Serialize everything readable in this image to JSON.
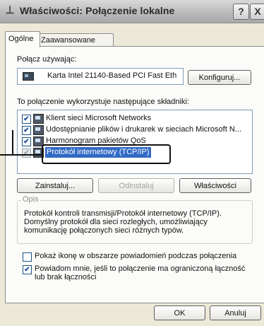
{
  "window": {
    "title": "Właściwości: Połączenie lokalne",
    "help_label": "?",
    "close_label": "X"
  },
  "tabs": [
    {
      "label": "Ogólne",
      "active": true
    },
    {
      "label": "Zaawansowane",
      "active": false
    }
  ],
  "connect_using": {
    "label": "Połącz używając:",
    "adapter": "Karta Intel 21140-Based PCI Fast Eth",
    "configure_button": "Konfiguruj..."
  },
  "components": {
    "label": "To połączenie wykorzystuje następujące składniki:",
    "items": [
      {
        "label": "Klient sieci Microsoft Networks",
        "checked": true,
        "check_mark": "✔"
      },
      {
        "label": "Udostępnianie plików i drukarek w sieciach Microsoft N...",
        "checked": true,
        "check_mark": "✔"
      },
      {
        "label": "Harmonogram pakietów QoS",
        "checked": true,
        "check_mark": "✔"
      },
      {
        "label": "Protokół internetowy (TCP/IP)",
        "checked": true,
        "check_mark": "✔",
        "selected": true
      }
    ]
  },
  "buttons": {
    "install": "Zainstaluj...",
    "uninstall": "Odinstaluj",
    "properties": "Właściwości"
  },
  "description": {
    "title": "Opis",
    "text": "Protokół kontroli transmisji/Protokół internetowy (TCP/IP). Domyślny protokół dla sieci rozległych, umożliwiający komunikację połączonych sieci różnych typów."
  },
  "options": {
    "show_icon": {
      "label": "Pokaż ikonę w obszarze powiadomień podczas połączenia",
      "checked": false
    },
    "notify": {
      "label": "Powiadom mnie, jeśli to połączenie ma ograniczoną łączność lub brak łączności",
      "checked": true,
      "check_mark": "✔"
    }
  },
  "footer": {
    "ok": "OK",
    "cancel": "Anuluj"
  },
  "colors": {
    "selection": "#316ac5",
    "accent": "#1c5180"
  }
}
